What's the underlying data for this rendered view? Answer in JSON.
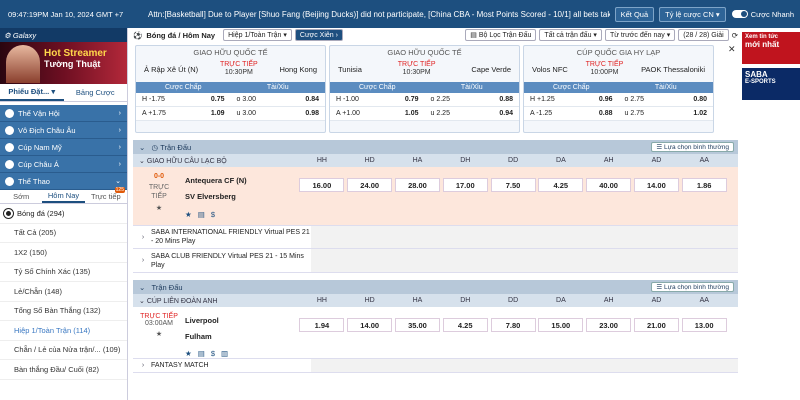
{
  "topbar": {
    "clock": "09:47:19PM Jan 10, 2024 GMT +7",
    "notice": "Attn:[Basketball] Due to Player [Shuo Fang (Beijing Ducks)] did not participate, [China CBA - Most Points Scored - 10/1] all bets taken",
    "results_button": "Kết Quả",
    "odds_type_select": "Tỷ lệ cược CN",
    "quick_bet_label": "Cược Nhanh"
  },
  "left": {
    "brand": "Galaxy",
    "banner_line1": "Hot Streamer",
    "banner_line2": "Tường Thuật",
    "tabs": [
      "Phiếu Đặt...",
      "Bảng Cược"
    ],
    "categories": [
      "Thể Vận Hội",
      "Vô Địch Châu Âu",
      "Cúp Nam Mỹ",
      "Cúp Châu Á",
      "Thể Thao"
    ],
    "sport_tabs": [
      "Sớm",
      "Hôm Nay",
      "Trực tiếp"
    ],
    "live_badge": "125",
    "sport_head": "Bóng đá (294)",
    "items": [
      "Tất Cả (205)",
      "1X2 (150)",
      "Tỷ Số Chính Xác (135)",
      "Lẻ/Chẵn (148)",
      "Tổng Số Bàn Thắng (132)",
      "Hiệp 1/Toàn Trận (114)",
      "Chẵn / Lẻ của Nửa trận/... (109)",
      "Bàn thắng Đầu/ Cuối (82)"
    ]
  },
  "main": {
    "title": "Bóng đá / Hôm Nay",
    "period_select": "Hiệp 1/Toàn Trận",
    "parlay_button": "Cược Xiên",
    "filter_league": "Bộ Lọc Trận Đấu",
    "filter_all": "Tất cả trận đấu",
    "filter_time": "Từ trước đến nay",
    "count": "(28 / 28) Giải",
    "market_labels": [
      "Cược Chấp",
      "Tài/Xỉu"
    ],
    "cards": [
      {
        "league": "GIAO HỮU QUỐC TẾ",
        "home": "Ả Rập Xê Út (N)",
        "away": "Hong Kong",
        "live": "TRỰC TIẾP",
        "time": "10:30PM",
        "rows": [
          {
            "h_label": "H -1.75",
            "h_odds": "0.75",
            "ou_label": "o 3.00",
            "ou_odds": "0.84"
          },
          {
            "h_label": "A +1.75",
            "h_odds": "1.09",
            "ou_label": "u 3.00",
            "ou_odds": "0.98"
          }
        ]
      },
      {
        "league": "GIAO HỮU QUỐC TẾ",
        "home": "Tunisia",
        "away": "Cape Verde",
        "live": "TRỰC TIẾP",
        "time": "10:30PM",
        "rows": [
          {
            "h_label": "H -1.00",
            "h_odds": "0.79",
            "ou_label": "o 2.25",
            "ou_odds": "0.88"
          },
          {
            "h_label": "A +1.00",
            "h_odds": "1.05",
            "ou_label": "u 2.25",
            "ou_odds": "0.94"
          }
        ]
      },
      {
        "league": "CÚP QUỐC GIA HY LẠP",
        "home": "Volos NFC",
        "away": "PAOK Thessaloniki",
        "live": "TRỰC TIẾP",
        "time": "10:00PM",
        "rows": [
          {
            "h_label": "H +1.25",
            "h_odds": "0.96",
            "ou_label": "o 2.75",
            "ou_odds": "0.80"
          },
          {
            "h_label": "A -1.25",
            "h_odds": "0.88",
            "ou_label": "u 2.75",
            "ou_odds": "1.02"
          }
        ]
      }
    ],
    "section_label": "Trận Đấu",
    "sort_button": "Lựa chọn bình thường",
    "columns": [
      "HH",
      "HD",
      "HA",
      "DH",
      "DD",
      "DA",
      "AH",
      "AD",
      "AA"
    ],
    "league1": "GIAO HỮU CÂU LẠC BỘ",
    "match1": {
      "score": "0-0",
      "status": "TRỰC TIẾP",
      "home": "Antequera CF (N)",
      "away": "SV Elversberg",
      "odds": [
        "16.00",
        "24.00",
        "28.00",
        "17.00",
        "7.50",
        "4.25",
        "40.00",
        "14.00",
        "1.86"
      ]
    },
    "collapsed1": "SABA INTERNATIONAL FRIENDLY Virtual PES 21 - 20 Mins Play",
    "collapsed2": "SABA CLUB FRIENDLY Virtual PES 21 - 15 Mins Play",
    "section2_label": "Trận Đấu",
    "league2": "CÚP LIÊN ĐOÀN ANH",
    "match2": {
      "status": "TRỰC TIẾP",
      "time": "03:00AM",
      "home": "Liverpool",
      "away": "Fulham",
      "odds": [
        "1.94",
        "14.00",
        "35.00",
        "4.25",
        "7.80",
        "15.00",
        "23.00",
        "21.00",
        "13.00"
      ]
    },
    "collapsed3": "FANTASY MATCH"
  },
  "ads": {
    "ad1_line1": "Xem tin tức",
    "ad1_line2": "mới nhất",
    "ad2_line1": "SABA",
    "ad2_line2": "E-SPORTS"
  },
  "colors": {
    "primary": "#1d4f7f",
    "live": "#e02424",
    "highlight_row": "#fde7dc"
  }
}
